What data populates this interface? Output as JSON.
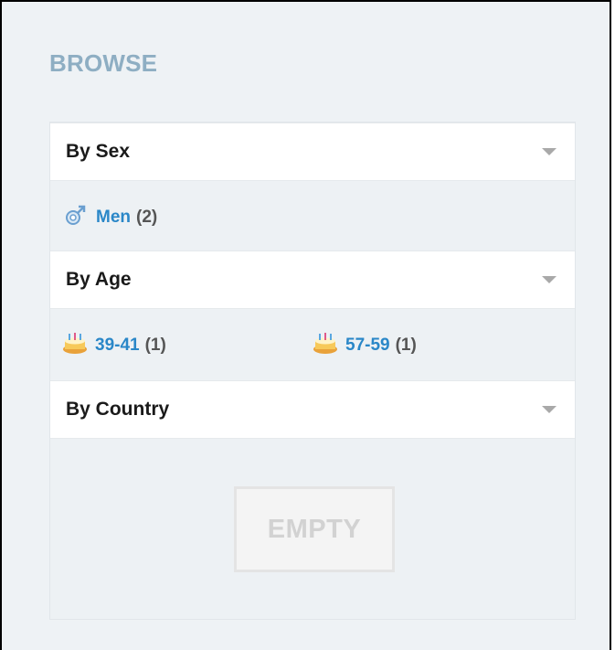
{
  "browse": {
    "title": "BROWSE"
  },
  "sections": {
    "sex": {
      "label": "By Sex",
      "items": [
        {
          "label": "Men",
          "count": "(2)",
          "icon": "male-icon"
        }
      ]
    },
    "age": {
      "label": "By Age",
      "items": [
        {
          "label": "39-41",
          "count": "(1)",
          "icon": "cake-icon"
        },
        {
          "label": "57-59",
          "count": "(1)",
          "icon": "cake-icon"
        }
      ]
    },
    "country": {
      "label": "By Country",
      "empty_label": "EMPTY"
    }
  },
  "colors": {
    "title": "#8eaec3",
    "link": "#2a87c8",
    "background": "#eef2f5"
  }
}
